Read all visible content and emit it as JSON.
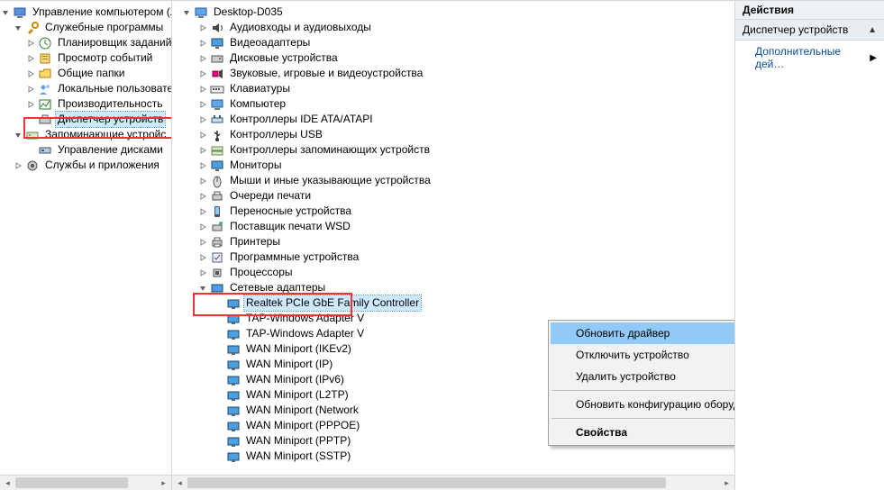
{
  "left_tree": {
    "root": {
      "label": "Управление компьютером (л",
      "expanded": true,
      "children": [
        {
          "label": "Служебные программы",
          "expanded": true,
          "children": [
            {
              "label": "Планировщик заданий",
              "icon": "scheduler",
              "expandable": true
            },
            {
              "label": "Просмотр событий",
              "icon": "events",
              "expandable": true
            },
            {
              "label": "Общие папки",
              "icon": "shared",
              "expandable": true
            },
            {
              "label": "Локальные пользовате",
              "icon": "users",
              "expandable": true
            },
            {
              "label": "Производительность",
              "icon": "perf",
              "expandable": true
            },
            {
              "label": "Диспетчер устройств",
              "icon": "devmgr",
              "expandable": false,
              "selected": true,
              "highlight_red": true
            }
          ]
        },
        {
          "label": "Запоминающие устройс",
          "expanded": true,
          "strike_red": true,
          "children": [
            {
              "label": "Управление дисками",
              "icon": "diskmgr",
              "expandable": false
            }
          ]
        },
        {
          "label": "Службы и приложения",
          "expanded": false
        }
      ]
    }
  },
  "center_tree": {
    "root": {
      "label": "Desktop-D035",
      "icon": "computer",
      "expanded": true,
      "children": [
        {
          "label": "Аудиовходы и аудиовыходы",
          "icon": "audio",
          "expandable": true
        },
        {
          "label": "Видеоадаптеры",
          "icon": "display",
          "expandable": true
        },
        {
          "label": "Дисковые устройства",
          "icon": "disk",
          "expandable": true
        },
        {
          "label": "Звуковые, игровые и видеоустройства",
          "icon": "sound",
          "expandable": true
        },
        {
          "label": "Клавиатуры",
          "icon": "keyboard",
          "expandable": true
        },
        {
          "label": "Компьютер",
          "icon": "computer",
          "expandable": true
        },
        {
          "label": "Контроллеры IDE ATA/ATAPI",
          "icon": "ide",
          "expandable": true
        },
        {
          "label": "Контроллеры USB",
          "icon": "usb",
          "expandable": true
        },
        {
          "label": "Контроллеры запоминающих устройств",
          "icon": "storage",
          "expandable": true
        },
        {
          "label": "Мониторы",
          "icon": "monitor",
          "expandable": true
        },
        {
          "label": "Мыши и иные указывающие устройства",
          "icon": "mouse",
          "expandable": true
        },
        {
          "label": "Очереди печати",
          "icon": "printq",
          "expandable": true
        },
        {
          "label": "Переносные устройства",
          "icon": "portable",
          "expandable": true
        },
        {
          "label": "Поставщик печати WSD",
          "icon": "wsd",
          "expandable": true
        },
        {
          "label": "Принтеры",
          "icon": "printer",
          "expandable": true
        },
        {
          "label": "Программные устройства",
          "icon": "soft",
          "expandable": true
        },
        {
          "label": "Процессоры",
          "icon": "cpu",
          "expandable": true
        },
        {
          "label": "Сетевые адаптеры",
          "icon": "net",
          "expanded": true,
          "highlight_red": true,
          "children": [
            {
              "label": "Realtek PCIe GbE Family Controller",
              "icon": "nic",
              "selected": true
            },
            {
              "label": "TAP-Windows Adapter V",
              "icon": "nic"
            },
            {
              "label": "TAP-Windows Adapter V",
              "icon": "nic"
            },
            {
              "label": "WAN Miniport (IKEv2)",
              "icon": "nic"
            },
            {
              "label": "WAN Miniport (IP)",
              "icon": "nic"
            },
            {
              "label": "WAN Miniport (IPv6)",
              "icon": "nic"
            },
            {
              "label": "WAN Miniport (L2TP)",
              "icon": "nic"
            },
            {
              "label": "WAN Miniport (Network",
              "icon": "nic"
            },
            {
              "label": "WAN Miniport (PPPOE)",
              "icon": "nic"
            },
            {
              "label": "WAN Miniport (PPTP)",
              "icon": "nic"
            },
            {
              "label": "WAN Miniport (SSTP)",
              "icon": "nic"
            }
          ]
        }
      ]
    }
  },
  "context_menu": {
    "items": [
      {
        "label": "Обновить драйвер",
        "highlighted": true,
        "highlight_red": true
      },
      {
        "label": "Отключить устройство"
      },
      {
        "label": "Удалить устройство"
      },
      {
        "sep": true
      },
      {
        "label": "Обновить конфигурацию оборудования"
      },
      {
        "sep": true
      },
      {
        "label": "Свойства",
        "bold": true
      }
    ]
  },
  "actions": {
    "header": "Действия",
    "group": "Диспетчер устройств",
    "link": "Дополнительные дей…"
  }
}
